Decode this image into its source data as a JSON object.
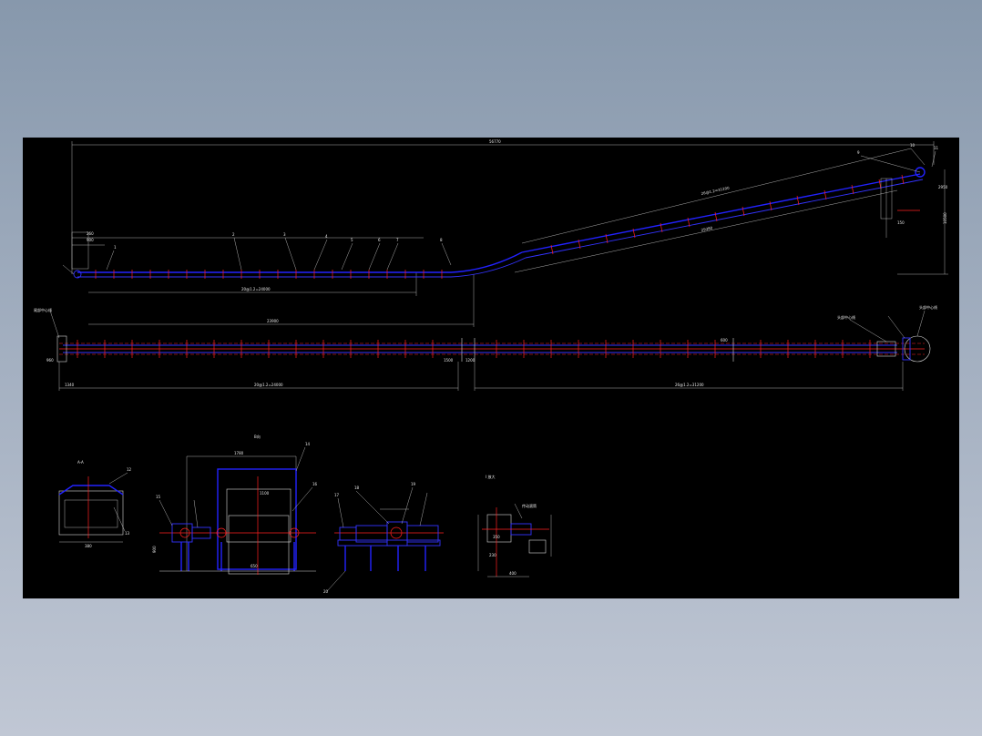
{
  "window": {
    "background_color": "#8fa0b3",
    "canvas_color": "#000000"
  },
  "colors": {
    "dimension": "#d8d8d8",
    "structure": "#2222ff",
    "centerline": "#ff2020",
    "text": "#e8e8e8"
  },
  "labels": {
    "overall_length": "56770",
    "dim_260": "260",
    "dim_900": "900",
    "dim_150": "150",
    "dim_1220": "1220",
    "lower_horizontal": "23900",
    "lower_spacing": "20@1.2=24000",
    "lower_lead": "4430",
    "upper_spacing": "26@1.2=31200",
    "incline_length": "29380",
    "top_drop": "2950",
    "right_height": "10500",
    "plan_left_dim": "1340",
    "plan_left_spacing": "20@1.2=24000",
    "plan_mid": "1500",
    "plan_right_spacing": "26@1.2=31200",
    "plan_gap": "1200",
    "plan_left_height": "960",
    "plan_right_mark": "600",
    "tail_note": "尾部中心线",
    "head_note_1": "头部中心线",
    "head_note_2": "头部中心线",
    "drive_note": "传动滚筒",
    "section_a": "A-A",
    "drive_view": "B向",
    "detail_view": "I 放大",
    "drive_width": "1780",
    "drive_frame": "1100",
    "drive_height": "650",
    "drive_bottom": "900",
    "drive_side": "380",
    "detail_dim_1": "350",
    "detail_dim_2": "230",
    "detail_dim_3": "400"
  },
  "part_callouts": [
    "1",
    "2",
    "3",
    "4",
    "5",
    "6",
    "7",
    "8",
    "9",
    "10",
    "11",
    "12",
    "13",
    "14",
    "15",
    "16",
    "17",
    "18",
    "19",
    "20"
  ]
}
